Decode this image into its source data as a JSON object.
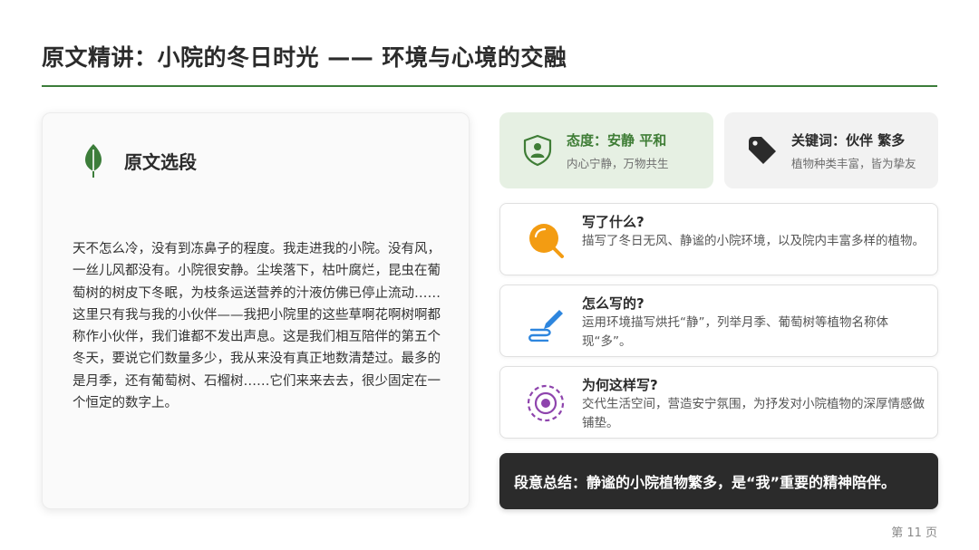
{
  "header": {
    "title": "原文精讲：小院的冬日时光 —— 环境与心境的交融"
  },
  "excerpt": {
    "heading": "原文选段",
    "icon": "leaf-icon",
    "paragraphs": [
      "天不怎么冷，没有到冻鼻子的程度。我走进我的小院。没有风，一丝儿风都没有。小院很安静。尘埃落下，枯叶腐烂，昆虫在葡萄树的树皮下冬眠，为枝条运送营养的汁液仿佛已停止流动……",
      "这里只有我与我的小伙伴——我把小院里的这些草啊花啊树啊都称作小伙伴，我们谁都不发出声息。这是我们相互陪伴的第五个冬天，要说它们数量多少，我从来没有真正地数清楚过。最多的是月季，还有葡萄树、石榴树……它们来来去去，很少固定在一个恒定的数字上。"
    ]
  },
  "tiles": {
    "attitude": {
      "icon": "shield-user-icon",
      "title": "态度：安静 平和",
      "subtitle": "内心宁静，万物共生"
    },
    "keywords": {
      "icon": "tag-icon",
      "title": "关键词：伙伴 繁多",
      "subtitle": "植物种类丰富，皆为挚友"
    }
  },
  "questions": [
    {
      "icon": "search-icon",
      "question": "写了什么?",
      "answer": "描写了冬日无风、静谧的小院环境，以及院内丰富多样的植物。"
    },
    {
      "icon": "pen-icon",
      "question": "怎么写的?",
      "answer": "运用环境描写烘托“静”，列举月季、葡萄树等植物名称体现“多”。"
    },
    {
      "icon": "target-icon",
      "question": "为何这样写?",
      "answer": "交代生活空间，营造安宁氛围，为抒发对小院植物的深厚情感做铺垫。"
    }
  ],
  "summary": {
    "text": "段意总结：静谧的小院植物繁多，是“我”重要的精神陪伴。"
  },
  "footer": {
    "page": "第 11 页"
  },
  "colors": {
    "accent_green": "#3c7d3a",
    "tile_green_bg": "#e6f0e3",
    "dark": "#2b2b2b",
    "orange": "#f39c12",
    "blue": "#2e86de",
    "purple": "#8e44ad"
  }
}
